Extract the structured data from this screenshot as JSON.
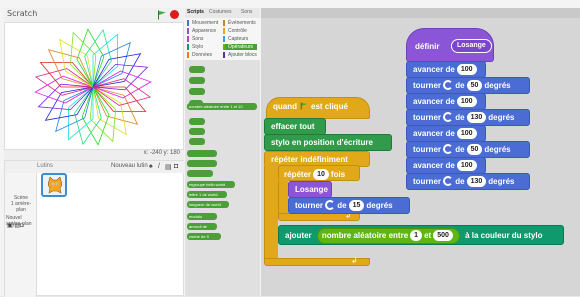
{
  "stage": {
    "title": "Scratch",
    "coords": "x: -240 y: 180"
  },
  "sprites": {
    "header_label": "Lutins",
    "new_sprite_label": "Nouveau lutin",
    "scene_label": "Scène",
    "scene_sub": "1 arrière-plan",
    "new_backdrop_label": "Nouvel arrière-plan",
    "sprite_name": "Sprite1"
  },
  "palette": {
    "tabs": [
      "Scripts",
      "Costumes",
      "Sons"
    ],
    "categories": [
      {
        "label": "Mouvement",
        "color": "#4a6cd4"
      },
      {
        "label": "Apparence",
        "color": "#8a55d7"
      },
      {
        "label": "Sons",
        "color": "#bb42c3"
      },
      {
        "label": "Stylo",
        "color": "#0e9a6c"
      },
      {
        "label": "Données",
        "color": "#ee7d16"
      },
      {
        "label": "Événements",
        "color": "#c88330"
      },
      {
        "label": "Contrôle",
        "color": "#e1a91a"
      },
      {
        "label": "Capteurs",
        "color": "#2ca5e2"
      },
      {
        "label": "Opérateurs",
        "color": "#5cb712"
      },
      {
        "label": "Ajouter blocs",
        "color": "#632d99"
      }
    ],
    "block_snippets": [
      "nombre aléatoire entre 1 et 10",
      "regroupe hello world",
      "lettre 1 de world",
      "longueur de world",
      "modulo",
      "arrondi de",
      "racine de 9"
    ]
  },
  "script": {
    "define_label": "définir",
    "define_name": "Losange",
    "define_body": [
      {
        "kind": "move",
        "label": "avancer de",
        "value": "100"
      },
      {
        "kind": "turn",
        "label": "tourner",
        "value": "50",
        "unit": "degrés"
      },
      {
        "kind": "move",
        "label": "avancer de",
        "value": "100"
      },
      {
        "kind": "turn",
        "label": "tourner",
        "value": "130",
        "unit": "degrés"
      },
      {
        "kind": "move",
        "label": "avancer de",
        "value": "100"
      },
      {
        "kind": "turn",
        "label": "tourner",
        "value": "50",
        "unit": "degrés"
      },
      {
        "kind": "move",
        "label": "avancer de",
        "value": "100"
      },
      {
        "kind": "turn",
        "label": "tourner",
        "value": "130",
        "unit": "degrés"
      }
    ],
    "when_flag_prefix": "quand",
    "when_flag_suffix": "est cliqué",
    "clear_label": "effacer tout",
    "pen_down_label": "stylo en position d'écriture",
    "forever_label": "répéter indéfiniment",
    "repeat_label": "répéter",
    "repeat_value": "10",
    "repeat_unit": "fois",
    "call_label": "Losange",
    "turn_label": "tourner",
    "turn_value": "15",
    "turn_unit": "degrés",
    "change_color_label": "ajouter",
    "random_label": "nombre aléatoire entre",
    "random_from": "1",
    "random_and": "et",
    "random_to": "500",
    "change_color_suffix": "à la couleur du stylo"
  }
}
